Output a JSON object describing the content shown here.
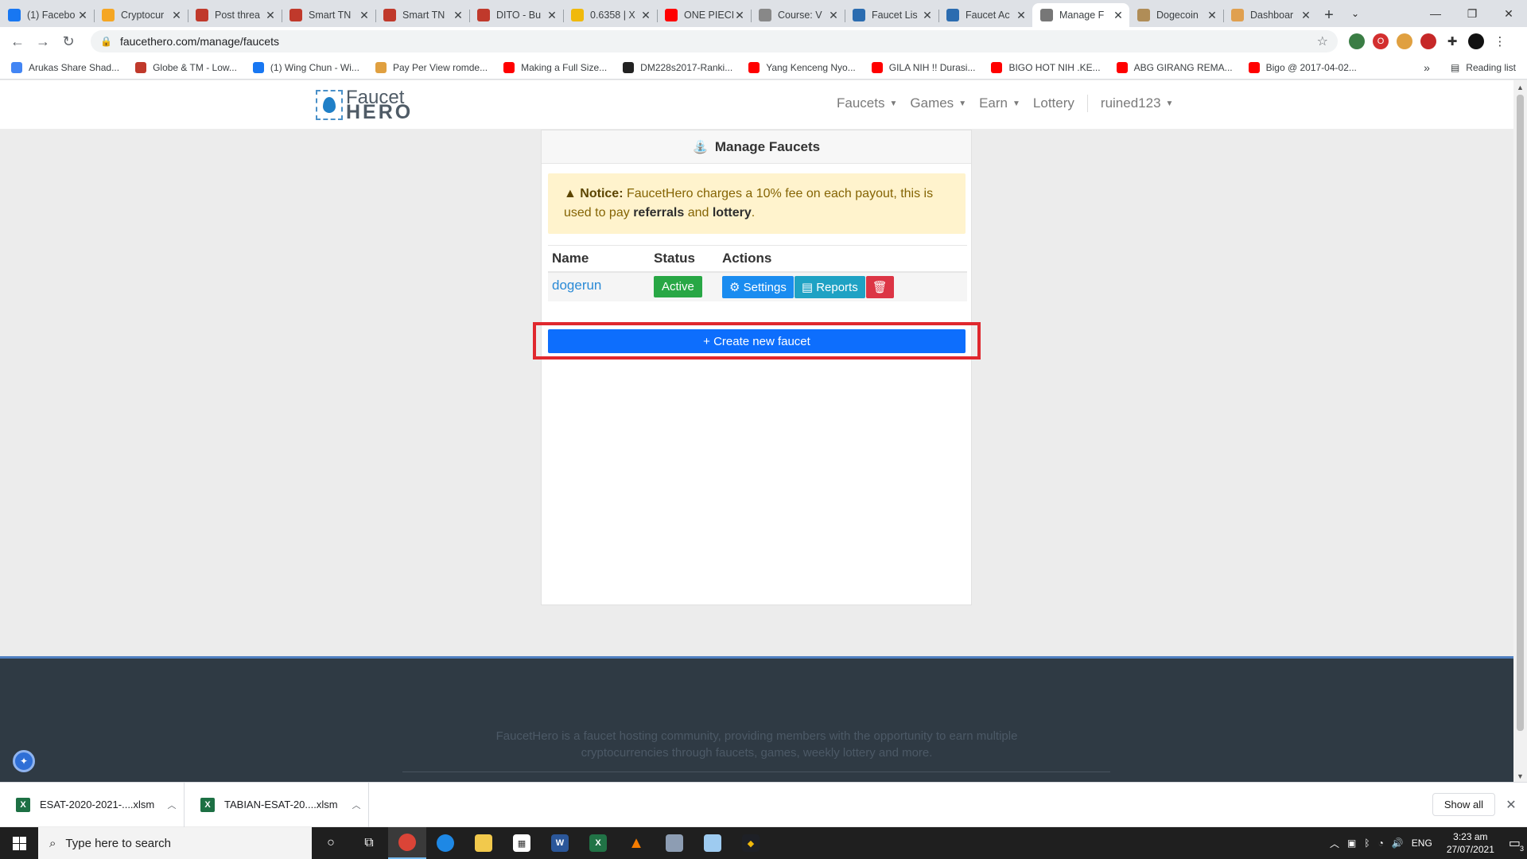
{
  "browser": {
    "tabs": [
      {
        "title": "(1) Facebo",
        "icon_color": "#1877f2",
        "icon": "facebook-icon"
      },
      {
        "title": "Cryptocur",
        "icon_color": "#f5a623",
        "icon": "crypto-icon"
      },
      {
        "title": "Post threa",
        "icon_color": "#c0392b",
        "icon": "shield-icon"
      },
      {
        "title": "Smart TN",
        "icon_color": "#c0392b",
        "icon": "shield-icon"
      },
      {
        "title": "Smart TN",
        "icon_color": "#c0392b",
        "icon": "shield-icon"
      },
      {
        "title": "DITO - Bu",
        "icon_color": "#c0392b",
        "icon": "shield-icon"
      },
      {
        "title": "0.6358 | X",
        "icon_color": "#f0b90b",
        "icon": "binance-icon"
      },
      {
        "title": "ONE PIECI",
        "icon_color": "#ff0000",
        "icon": "youtube-icon"
      },
      {
        "title": "Course: V",
        "icon_color": "#888888",
        "icon": "course-icon"
      },
      {
        "title": "Faucet Lis",
        "icon_color": "#2b6cb0",
        "icon": "faucetpay-icon"
      },
      {
        "title": "Faucet Ac",
        "icon_color": "#2b6cb0",
        "icon": "faucetpay-icon"
      },
      {
        "title": "Manage F",
        "icon_color": "#777777",
        "icon": "drop-icon",
        "active": true
      },
      {
        "title": "Dogecoin",
        "icon_color": "#b08d57",
        "icon": "drop-icon"
      },
      {
        "title": "Dashboar",
        "icon_color": "#e0a050",
        "icon": "dashboard-icon"
      }
    ],
    "url": "faucethero.com/manage/faucets",
    "bookmarks": [
      {
        "label": "Arukas Share Shad...",
        "color": "#4285f4"
      },
      {
        "label": "Globe & TM - Low...",
        "color": "#c0392b"
      },
      {
        "label": "(1) Wing Chun - Wi...",
        "color": "#1877f2"
      },
      {
        "label": "Pay Per View romde...",
        "color": "#e0a040"
      },
      {
        "label": "Making a Full Size...",
        "color": "#ff0000"
      },
      {
        "label": "DM228s2017-Ranki...",
        "color": "#222222"
      },
      {
        "label": "Yang Kenceng Nyo...",
        "color": "#ff0000"
      },
      {
        "label": "GILA NIH !! Durasi...",
        "color": "#ff0000"
      },
      {
        "label": "BIGO HOT NIH .KE...",
        "color": "#ff0000"
      },
      {
        "label": "ABG GIRANG REMA...",
        "color": "#ff0000"
      },
      {
        "label": "Bigo @ 2017-04-02...",
        "color": "#ff0000"
      }
    ],
    "more_bookmarks": "»",
    "reading_list": "Reading list"
  },
  "site": {
    "logo_line1": "Faucet",
    "logo_line2": "HERO",
    "menu": {
      "faucets": "Faucets",
      "games": "Games",
      "earn": "Earn",
      "lottery": "Lottery",
      "user": "ruined123"
    },
    "card_title": "Manage Faucets",
    "notice": {
      "label": "Notice:",
      "text1": "FaucetHero charges a 10% fee on each payout, this is used to pay",
      "ref": "referrals",
      "and": "and",
      "lottery": "lottery",
      "dot": "."
    },
    "table": {
      "headers": [
        "Name",
        "Status",
        "Actions"
      ],
      "rows": [
        {
          "name": "dogerun",
          "status": "Active",
          "settings": "Settings",
          "reports": "Reports"
        }
      ]
    },
    "create_button": "+ Create new faucet",
    "footer_text": "FaucetHero is a faucet hosting community, providing members with the opportunity to earn multiple cryptocurrencies through faucets, games, weekly lottery and more.",
    "colors": {
      "primary": "#0d6efd",
      "success": "#28a745",
      "danger": "#dc3545",
      "highlight": "#e0282e"
    }
  },
  "downloads": {
    "items": [
      "ESAT-2020-2021-....xlsm",
      "TABIAN-ESAT-20....xlsm"
    ],
    "show_all": "Show all"
  },
  "taskbar": {
    "search_placeholder": "Type here to search",
    "lang": "ENG",
    "time": "3:23 am",
    "date": "27/07/2021",
    "notif_count": "3"
  }
}
